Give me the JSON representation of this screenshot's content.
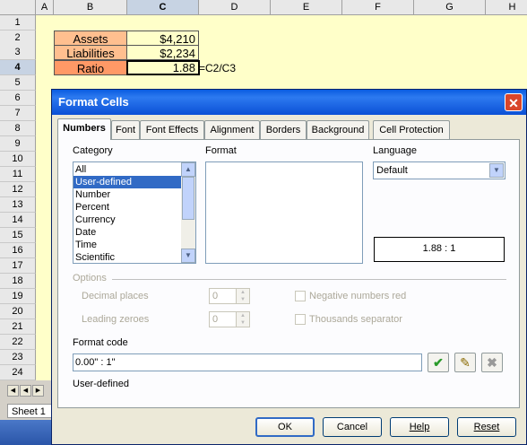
{
  "spreadsheet": {
    "columns": [
      "A",
      "B",
      "C",
      "D",
      "E",
      "F",
      "G",
      "H"
    ],
    "rows": [
      "1",
      "2",
      "3",
      "4",
      "5",
      "6",
      "7",
      "8",
      "9",
      "10",
      "11",
      "12",
      "13",
      "14",
      "15",
      "16",
      "17",
      "18",
      "19",
      "20",
      "21",
      "22",
      "23",
      "24"
    ],
    "cells": {
      "b2": "Assets",
      "c2": "$4,210",
      "b3": "Liabilities",
      "c3": "$2,234",
      "b4": "Ratio",
      "c4": "1.88",
      "d4_formula": "=C2/C3"
    },
    "sheet_tab": "Sheet 1"
  },
  "dialog": {
    "title": "Format Cells",
    "tabs": [
      "Numbers",
      "Font",
      "Font Effects",
      "Alignment",
      "Borders",
      "Background",
      "Cell Protection"
    ],
    "category_label": "Category",
    "categories": [
      "All",
      "User-defined",
      "Number",
      "Percent",
      "Currency",
      "Date",
      "Time",
      "Scientific"
    ],
    "selected_category": "User-defined",
    "format_label": "Format",
    "language_label": "Language",
    "language_value": "Default",
    "preview": "1.88 : 1",
    "options_label": "Options",
    "decimal_places_label": "Decimal places",
    "decimal_places_value": "0",
    "leading_zeroes_label": "Leading zeroes",
    "leading_zeroes_value": "0",
    "negative_red_label": "Negative numbers red",
    "thousands_sep_label": "Thousands separator",
    "format_code_label": "Format code",
    "format_code_value": "0.00\" : 1\"",
    "format_code_display": "0.00\" : 1\"",
    "status": "User-defined",
    "buttons": {
      "ok": "OK",
      "cancel": "Cancel",
      "help": "Help",
      "reset": "Reset"
    }
  }
}
